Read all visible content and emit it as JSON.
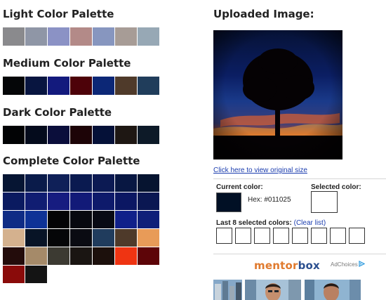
{
  "palettes": {
    "light": {
      "title": "Light Color Palette",
      "colors": [
        "#8a8a8d",
        "#8f96a6",
        "#8b92c5",
        "#b38a88",
        "#8796bf",
        "#a79c96",
        "#97a8b5"
      ]
    },
    "medium": {
      "title": "Medium Color Palette",
      "colors": [
        "#050608",
        "#081540",
        "#131a7d",
        "#4d0209",
        "#0c2776",
        "#4f3a2a",
        "#203d5b"
      ]
    },
    "dark": {
      "title": "Dark Color Palette",
      "colors": [
        "#020305",
        "#040b1c",
        "#0b0e3b",
        "#1d0407",
        "#051138",
        "#1e1713",
        "#0d1a28"
      ]
    },
    "complete": {
      "title": "Complete Color Palette",
      "colors": [
        "#061533",
        "#0a1b4a",
        "#0f2058",
        "#0a1a50",
        "#0c1a53",
        "#081742",
        "#061430",
        "#0a1a60",
        "#101d72",
        "#161c80",
        "#121a78",
        "#0e1a6b",
        "#0b1763",
        "#0a1752",
        "#0f2c85",
        "#0e3296",
        "#030305",
        "#07080f",
        "#080a14",
        "#10208a",
        "#0f1f79",
        "#d4b18e",
        "#081426",
        "#050608",
        "#0a0b12",
        "#203c5d",
        "#4e3a2a",
        "#e89b58",
        "#230c0b",
        "#a58a69",
        "#3c3a32",
        "#1a1512",
        "#1c100c",
        "#ef3412",
        "#5d0508",
        "#8a0b0a",
        "#141414"
      ]
    }
  },
  "uploaded": {
    "title": "Uploaded Image:",
    "view_link": "Click here to view original size"
  },
  "current": {
    "label": "Current color:",
    "hex_prefix": "Hex: ",
    "hex": "#011025",
    "color": "#011025"
  },
  "selected": {
    "label": "Selected color:"
  },
  "history": {
    "label": "Last 8 selected colors:",
    "clear": "(Clear list)",
    "slots": [
      "",
      "",
      "",
      "",
      "",
      "",
      "",
      ""
    ]
  },
  "ad": {
    "brand_part1": "mentor",
    "brand_part2": "box",
    "choices": "AdChoices",
    "choices_icon": "adchoices-triangle-icon"
  }
}
